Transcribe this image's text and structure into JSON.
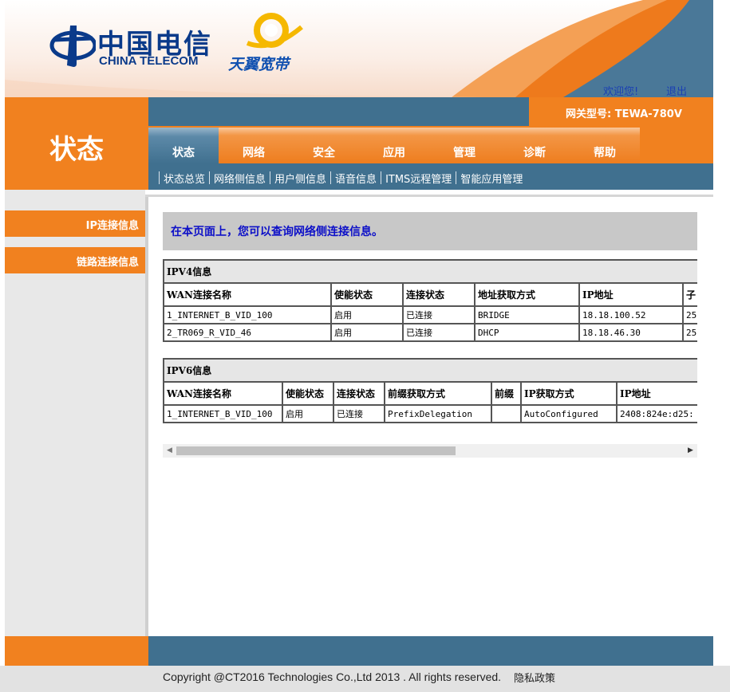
{
  "header": {
    "brand_cn": "中国电信",
    "brand_en": "CHINA TELECOM",
    "product_brand": "天翼宽带",
    "welcome": "欢迎您!",
    "logout": "退出",
    "gateway_model": "网关型号: TEWA-780V"
  },
  "section_title": "状态",
  "tabs": [
    "状态",
    "网络",
    "安全",
    "应用",
    "管理",
    "诊断",
    "帮助"
  ],
  "active_tab": "状态",
  "subnav": [
    "状态总览",
    "网络侧信息",
    "用户侧信息",
    "语音信息",
    "ITMS远程管理",
    "智能应用管理"
  ],
  "active_subnav": "网络侧信息",
  "sidebar": [
    "IP连接信息",
    "链路连接信息"
  ],
  "info_text": "在本页面上，您可以查询网络侧连接信息。",
  "ipv4": {
    "caption": "IPV4信息",
    "headers": [
      "WAN连接名称",
      "使能状态",
      "连接状态",
      "地址获取方式",
      "IP地址",
      "子"
    ],
    "rows": [
      [
        "1_INTERNET_B_VID_100",
        "启用",
        "已连接",
        "BRIDGE",
        "18.18.100.52",
        "25"
      ],
      [
        "2_TR069_R_VID_46",
        "启用",
        "已连接",
        "DHCP",
        "18.18.46.30",
        "25"
      ]
    ]
  },
  "ipv6": {
    "caption": "IPV6信息",
    "headers": [
      "WAN连接名称",
      "使能状态",
      "连接状态",
      "前缀获取方式",
      "前缀",
      "IP获取方式",
      "IP地址"
    ],
    "rows": [
      [
        "1_INTERNET_B_VID_100",
        "启用",
        "已连接",
        "PrefixDelegation",
        "",
        "AutoConfigured",
        "2408:824e:d25:"
      ]
    ]
  },
  "footer": {
    "copyright": "Copyright @CT2016 Technologies Co.,Ltd 2013 . All rights reserved.",
    "privacy": "隐私政策"
  },
  "colors": {
    "orange": "#f1811f",
    "steel_blue": "#40708f",
    "link_blue": "#1a3fb4",
    "info_blue": "#0d10c8"
  }
}
